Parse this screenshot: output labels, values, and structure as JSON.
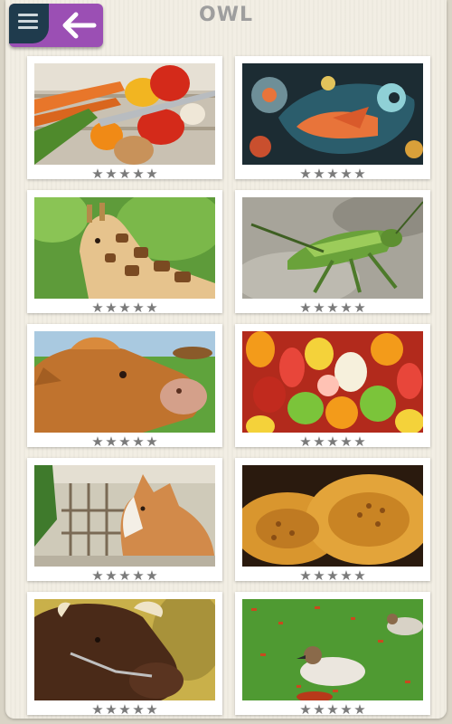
{
  "header": {
    "title": "OWL",
    "menu_icon": "hamburger-menu-icon",
    "back_icon": "back-arrow-icon"
  },
  "colors": {
    "nav_accent": "#9b4fb4",
    "menu_tab": "#1f3b4d",
    "star": "#7a7a7a",
    "title": "#9e9e9e"
  },
  "gallery": {
    "items": [
      {
        "subject": "vegetables",
        "rating": 0
      },
      {
        "subject": "fish-art",
        "rating": 0
      },
      {
        "subject": "giraffe",
        "rating": 0
      },
      {
        "subject": "grasshopper",
        "rating": 0
      },
      {
        "subject": "cow",
        "rating": 0
      },
      {
        "subject": "gummy-bears",
        "rating": 0
      },
      {
        "subject": "cat",
        "rating": 0
      },
      {
        "subject": "bread",
        "rating": 0
      },
      {
        "subject": "bull",
        "rating": 0
      },
      {
        "subject": "ducks",
        "rating": 0
      }
    ]
  }
}
